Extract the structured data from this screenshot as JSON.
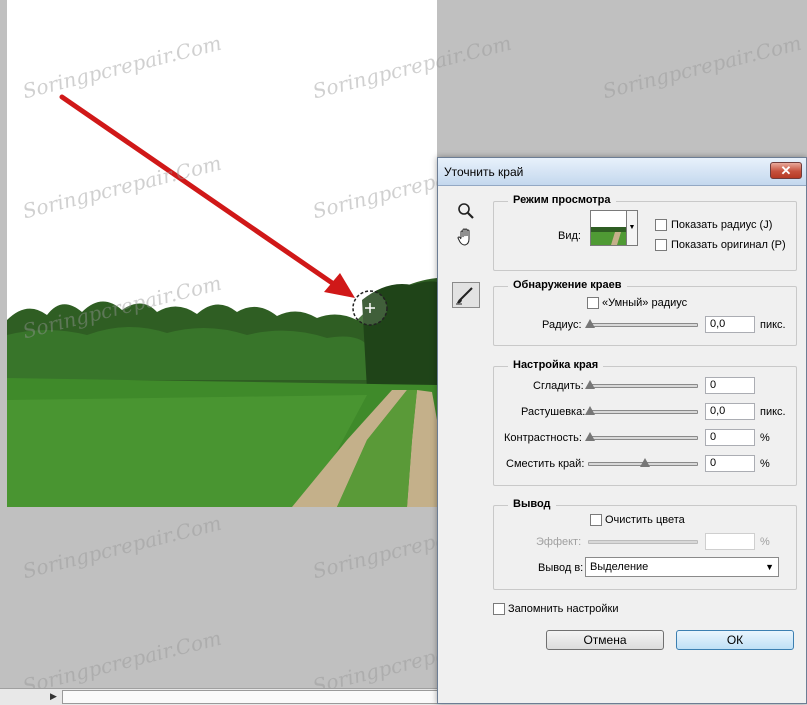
{
  "watermark": "Soringpcrepair.Com",
  "dialog": {
    "title": "Уточнить край",
    "close_symbol": "✕",
    "tools": {
      "zoom_icon": "zoom-icon",
      "hand_icon": "hand-icon",
      "brush_icon": "refine-radius-brush-icon"
    },
    "view_mode": {
      "legend": "Режим просмотра",
      "view_label": "Вид:",
      "show_radius": "Показать радиус (J)",
      "show_original": "Показать оригинал (P)",
      "show_radius_checked": false,
      "show_original_checked": false
    },
    "edge_detection": {
      "legend": "Обнаружение краев",
      "smart_radius": "«Умный» радиус",
      "smart_radius_checked": false,
      "radius_label": "Радиус:",
      "radius_value": "0,0",
      "radius_unit": "пикс.",
      "radius_level": 0
    },
    "adjust_edge": {
      "legend": "Настройка края",
      "smooth_label": "Сгладить:",
      "smooth_value": "0",
      "smooth_level": 0,
      "feather_label": "Растушевка:",
      "feather_value": "0,0",
      "feather_unit": "пикс.",
      "feather_level": 0,
      "contrast_label": "Контрастность:",
      "contrast_value": "0",
      "contrast_unit": "%",
      "contrast_level": 0,
      "shift_label": "Сместить край:",
      "shift_value": "0",
      "shift_unit": "%",
      "shift_level": 0.5
    },
    "output": {
      "legend": "Вывод",
      "decontaminate": "Очистить цвета",
      "decontaminate_checked": false,
      "amount_label": "Эффект:",
      "amount_unit": "%",
      "output_to_label": "Вывод в:",
      "output_to_value": "Выделение",
      "output_to_options": [
        "Выделение"
      ]
    },
    "remember_settings": "Запомнить настройки",
    "remember_checked": false,
    "cancel_label": "Отмена",
    "ok_label": "ОК"
  },
  "colors": {
    "canvas_gray": "#c0c0c0",
    "arrow_red": "#d01818",
    "ok_accent": "#3c7fb1"
  }
}
